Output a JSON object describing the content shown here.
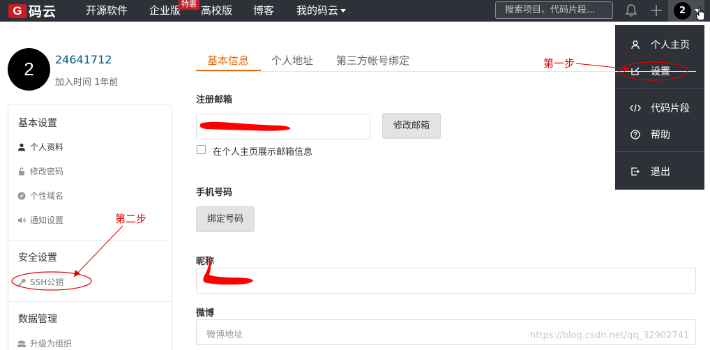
{
  "brand": {
    "logo_letter": "G",
    "logo_text": "码云"
  },
  "nav": {
    "items": [
      "开源软件",
      "企业版",
      "高校版",
      "博客",
      "我的码云"
    ],
    "badge": "特惠",
    "search_placeholder": "搜索项目、代码片段...",
    "avatar_letter": "2"
  },
  "dropdown": {
    "items": [
      "个人主页",
      "设置",
      "代码片段",
      "帮助",
      "退出"
    ]
  },
  "profile": {
    "avatar_letter": "2",
    "user_id": "24641712",
    "joined": "加入时间 1年前"
  },
  "sidebar": {
    "basic_heading": "基本设置",
    "basic_items": [
      "个人资料",
      "修改密码",
      "个性域名",
      "通知设置"
    ],
    "security_heading": "安全设置",
    "security_items": [
      "SSH公钥"
    ],
    "data_heading": "数据管理",
    "data_items": [
      "升级为组织"
    ]
  },
  "tabs": [
    "基本信息",
    "个人地址",
    "第三方帐号绑定"
  ],
  "form": {
    "email_label": "注册邮箱",
    "change_email_button": "修改邮箱",
    "show_email_label": "在个人主页展示邮箱信息",
    "phone_label": "手机号码",
    "bind_phone_button": "绑定号码",
    "nickname_label": "昵称",
    "weibo_label": "微博",
    "weibo_placeholder": "微博地址"
  },
  "annotations": {
    "step1": "第一步",
    "step2": "第二步"
  },
  "watermark": "https://blog.csdn.net/qq_32902741",
  "colors": {
    "nav_bg": "#2e3138",
    "accent": "#e06e1a",
    "brand_red": "#c71d23",
    "annotation_red": "#e00000"
  }
}
